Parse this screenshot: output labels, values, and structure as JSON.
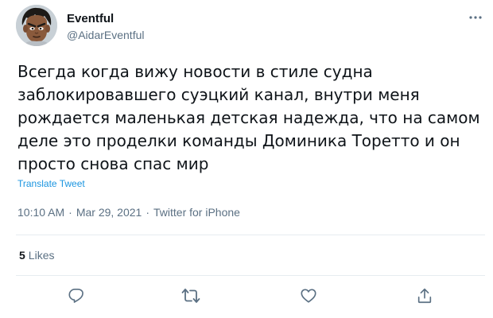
{
  "tweet": {
    "author_name": "Eventful",
    "author_handle": "@AidarEventful",
    "text": "Всегда когда вижу новости в стиле судна\nзаблокировавшего суэцкий канал, внутри меня\nрождается маленькая детская надежда, что на самом\nделе это проделки команды Доминика Торетто и он\nпросто снова спас мир",
    "translate_label": "Translate Tweet",
    "time": "10:10 AM",
    "separator": "·",
    "date": "Mar 29, 2021",
    "source": "Twitter for iPhone",
    "likes_count": "5",
    "likes_label": "Likes"
  },
  "icons": {
    "more": "more-icon",
    "reply": "reply-icon",
    "retweet": "retweet-icon",
    "like": "heart-icon",
    "share": "share-icon"
  },
  "colors": {
    "text": "#0f1419",
    "secondary": "#5b7083",
    "link": "#1b95e0",
    "divider": "#e6ecf0"
  }
}
